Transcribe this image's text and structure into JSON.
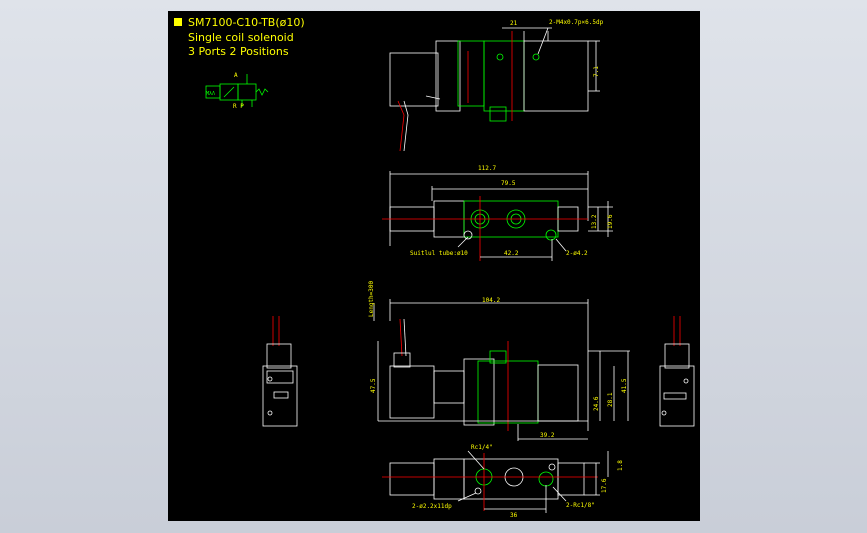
{
  "title": {
    "line1": "SM7100-C10-TB(ø10)",
    "line2": "Single coil solenoid",
    "line3": "3 Ports 2 Positions"
  },
  "symbol": {
    "port_a": "A",
    "port_rp": "R P",
    "left_box": "MλΛ"
  },
  "top_view": {
    "dim_21": "21",
    "note_m4": "2-M4x0.7p×6.5dp",
    "dim_7_1": "7.1"
  },
  "side_view": {
    "dim_112_7": "112.7",
    "dim_79_5": "79.5",
    "dim_13_2": "13.2",
    "dim_19_6": "19.6",
    "suitable_tube": "Suitlul tube:ø10",
    "dim_42_2": "42.2",
    "note_hole": "2-ø4.2"
  },
  "front_view": {
    "length_note": "Length=300",
    "dim_104_2": "104.2",
    "dim_47_5": "47.5",
    "dim_24_6": "24.6",
    "dim_28_1": "28.1",
    "dim_41_5": "41.5",
    "dim_39_2": "39.2"
  },
  "bottom_view": {
    "rc14": "Rc1/4\"",
    "rc18": "2-Rc1/8\"",
    "note_2x": "2-ø2.2x11dp",
    "dim_36": "36",
    "dim_1_8": "1.8",
    "dim_17_6": "17.6"
  }
}
